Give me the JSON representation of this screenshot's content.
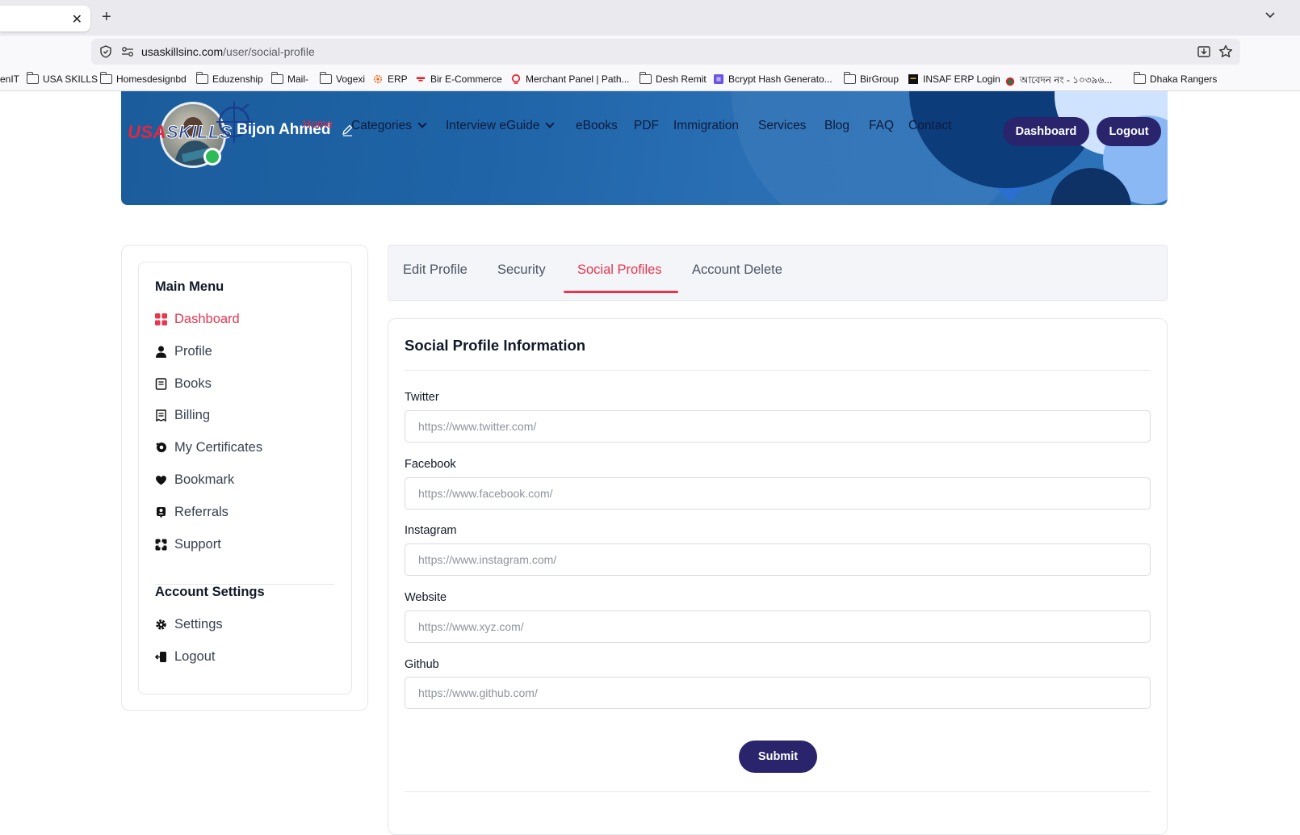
{
  "browser": {
    "url_domain": "usaskillsinc.com",
    "url_path": "/user/social-profile",
    "bookmarks": [
      {
        "label": "enIT",
        "icon": "none"
      },
      {
        "label": "USA SKILLS",
        "icon": "folder-icon"
      },
      {
        "label": "Homesdesignbd",
        "icon": "folder-icon"
      },
      {
        "label": "Eduzenship",
        "icon": "folder-icon"
      },
      {
        "label": "Mail-",
        "icon": "folder-icon"
      },
      {
        "label": "Vogexi",
        "icon": "folder-icon"
      },
      {
        "label": "ERP",
        "icon": "erp-favicon"
      },
      {
        "label": "Bir E-Commerce",
        "icon": "bir-favicon"
      },
      {
        "label": "Merchant Panel | Path...",
        "icon": "pathao-favicon"
      },
      {
        "label": "Desh Remit",
        "icon": "folder-icon"
      },
      {
        "label": "Bcrypt Hash Generato...",
        "icon": "bcrypt-favicon"
      },
      {
        "label": "BirGroup",
        "icon": "folder-icon"
      },
      {
        "label": "INSAF ERP Login",
        "icon": "insaf-favicon"
      },
      {
        "label": "আবেদন নং - ১০৩৯৬...",
        "icon": "govbd-favicon"
      },
      {
        "label": "Dhaka Rangers",
        "icon": "folder-icon"
      }
    ]
  },
  "header": {
    "logo_usa": "USA",
    "logo_skills": "SKILLS",
    "user_name": "Bijon Ahmed",
    "nav": {
      "home": "Home",
      "categories": "Categories",
      "interview": "Interview eGuide",
      "ebooks": "eBooks",
      "pdf": "PDF",
      "immigration": "Immigration",
      "services": "Services",
      "blog": "Blog",
      "faq": "FAQ",
      "contact": "Contact"
    },
    "dashboard_btn": "Dashboard",
    "logout_btn": "Logout"
  },
  "sidebar": {
    "main_menu_heading": "Main Menu",
    "items": [
      {
        "label": "Dashboard",
        "icon": "dashboard-icon"
      },
      {
        "label": "Profile",
        "icon": "user-icon"
      },
      {
        "label": "Books",
        "icon": "book-icon"
      },
      {
        "label": "Billing",
        "icon": "receipt-icon"
      },
      {
        "label": "My Certificates",
        "icon": "certificate-icon"
      },
      {
        "label": "Bookmark",
        "icon": "heart-icon"
      },
      {
        "label": "Referrals",
        "icon": "referral-icon"
      },
      {
        "label": "Support",
        "icon": "support-icon"
      }
    ],
    "account_heading": "Account Settings",
    "account_items": [
      {
        "label": "Settings",
        "icon": "gear-icon"
      },
      {
        "label": "Logout",
        "icon": "logout-icon"
      }
    ]
  },
  "tabs": [
    {
      "label": "Edit Profile"
    },
    {
      "label": "Security"
    },
    {
      "label": "Social Profiles"
    },
    {
      "label": "Account Delete"
    }
  ],
  "form": {
    "title": "Social Profile Information",
    "fields": [
      {
        "label": "Twitter",
        "placeholder": "https://www.twitter.com/",
        "value": ""
      },
      {
        "label": "Facebook",
        "placeholder": "https://www.facebook.com/",
        "value": ""
      },
      {
        "label": "Instagram",
        "placeholder": "https://www.instagram.com/",
        "value": ""
      },
      {
        "label": "Website",
        "placeholder": "https://www.xyz.com/",
        "value": ""
      },
      {
        "label": "Github",
        "placeholder": "https://www.github.com/",
        "value": ""
      }
    ],
    "submit_label": "Submit"
  },
  "colors": {
    "accent": "#e8364f",
    "primary_button": "#29246b",
    "header_blue": "#1e64a6"
  }
}
